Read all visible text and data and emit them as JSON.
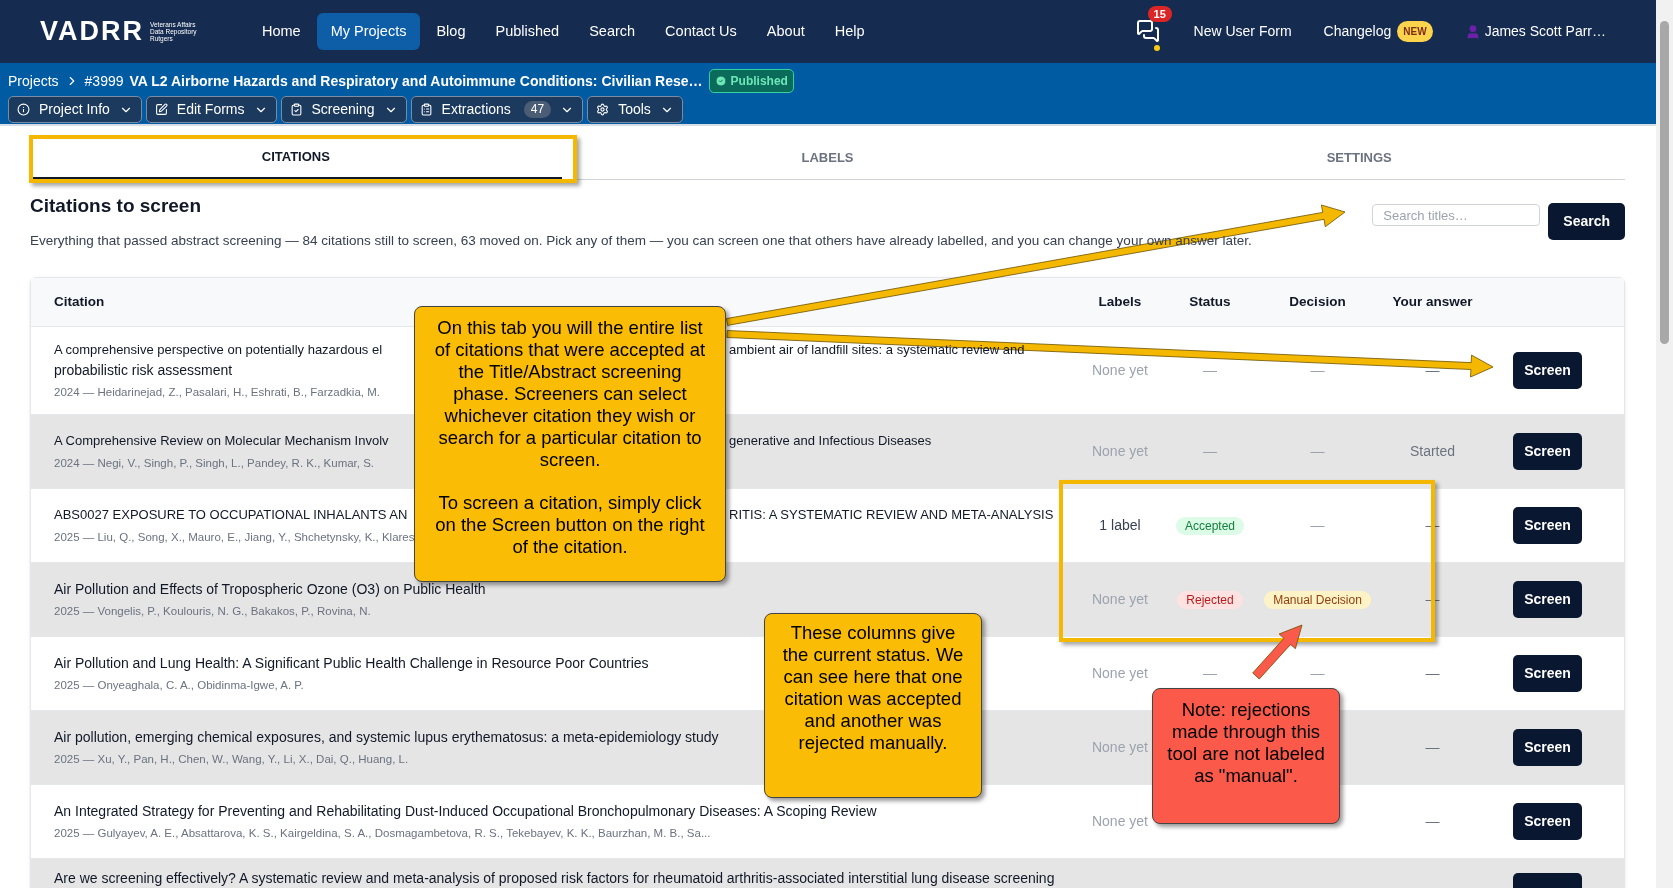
{
  "nav": {
    "logo": {
      "word": "VADRR",
      "tagline": [
        "Veterans Affairs",
        "Data Repository",
        "Rutgers"
      ]
    },
    "links": [
      {
        "label": "Home",
        "selected": false
      },
      {
        "label": "My Projects",
        "selected": true
      },
      {
        "label": "Blog",
        "selected": false
      },
      {
        "label": "Published",
        "selected": false
      },
      {
        "label": "Search",
        "selected": false
      },
      {
        "label": "Contact Us",
        "selected": false
      },
      {
        "label": "About",
        "selected": false
      },
      {
        "label": "Help",
        "selected": false
      }
    ],
    "messages_count": "15",
    "new_user_form": "New User Form",
    "changelog": {
      "label": "Changelog",
      "badge": "NEW"
    },
    "user": "James Scott Parr…"
  },
  "project_bar": {
    "breadcrumb": "Projects",
    "number": "#3999",
    "title": "VA L2 Airborne Hazards and Respiratory and Autoimmune Conditions: Civilian Rese…",
    "status": "Published",
    "menus": [
      {
        "label": "Project Info"
      },
      {
        "label": "Edit Forms"
      },
      {
        "label": "Screening"
      },
      {
        "label": "Extractions",
        "count": "47"
      },
      {
        "label": "Tools"
      }
    ]
  },
  "tabs": [
    {
      "label": "CITATIONS",
      "selected": true
    },
    {
      "label": "LABELS",
      "selected": false
    },
    {
      "label": "SETTINGS",
      "selected": false
    }
  ],
  "section": {
    "title": "Citations to screen",
    "subtitle": "Everything that passed abstract screening — 84 citations still to screen, 63 moved on. Pick any of them — you can screen one that others have already labelled, and you can change your own answer later.",
    "search": {
      "placeholder": "Search titles…",
      "button": "Search"
    }
  },
  "table": {
    "columns": [
      "Citation",
      "Labels",
      "Status",
      "Decision",
      "Your answer"
    ],
    "rows": [
      {
        "title_lines": [
          [
            "A comprehensive perspective on potentially hazardous el",
            "ambient air of landfill sites: a systematic review and"
          ],
          [
            "probabilistic risk assessment"
          ]
        ],
        "authors": "2024 — Heidarinejad, Z., Pasalari, H., Eshrati, B., Farzadkia, M.",
        "labels": "None yet",
        "status": {
          "text": "—",
          "kind": "none"
        },
        "decision": {
          "text": "—",
          "kind": "none"
        },
        "answer": "—",
        "action": "Screen"
      },
      {
        "title_lines": [
          [
            "A Comprehensive Review on Molecular Mechanism Involv",
            "generative and Infectious Diseases"
          ]
        ],
        "authors": "2024 — Negi, V., Singh, P., Singh, L., Pandey, R. K., Kumar, S.",
        "labels": "None yet",
        "status": {
          "text": "—",
          "kind": "none"
        },
        "decision": {
          "text": "—",
          "kind": "none"
        },
        "answer": "Started",
        "action": "Screen"
      },
      {
        "title_lines": [
          [
            "ABS0027 EXPOSURE TO OCCUPATIONAL INHALANTS AN",
            "RITIS: A SYSTEMATIC REVIEW AND META-ANALYSIS"
          ]
        ],
        "authors": "2025 — Liu, Q., Song, X., Mauro, E., Jiang, Y., Shchetynsky, K., Klares",
        "labels": "1 label",
        "status": {
          "text": "Accepted",
          "kind": "accepted"
        },
        "decision": {
          "text": "—",
          "kind": "none"
        },
        "answer": "—",
        "action": "Screen"
      },
      {
        "title_lines": [
          [
            "Air Pollution and Effects of Tropospheric Ozone (O3) on Public Health"
          ]
        ],
        "authors": "2025 — Vongelis, P., Koulouris, N. G., Bakakos, P., Rovina, N.",
        "labels": "None yet",
        "status": {
          "text": "Rejected",
          "kind": "rejected"
        },
        "decision": {
          "text": "Manual Decision",
          "kind": "manual"
        },
        "answer": "—",
        "action": "Screen"
      },
      {
        "title_lines": [
          [
            "Air Pollution and Lung Health: A Significant Public Health Challenge in Resource Poor Countries"
          ]
        ],
        "authors": "2025 — Onyeaghala, C. A., Obidinma-Igwe, A. P.",
        "labels": "None yet",
        "status": {
          "text": "—",
          "kind": "none"
        },
        "decision": {
          "text": "—",
          "kind": "none"
        },
        "answer": "—",
        "action": "Screen"
      },
      {
        "title_lines": [
          [
            "Air pollution, emerging chemical exposures, and systemic lupus erythematosus: a meta-epidemiology study"
          ]
        ],
        "authors": "2025 — Xu, Y., Pan, H., Chen, W., Wang, Y., Li, X., Dai, Q., Huang, L.",
        "labels": "None yet",
        "answer": "—",
        "action": "Screen"
      },
      {
        "title_lines": [
          [
            "An Integrated Strategy for Preventing and Rehabilitating Dust-Induced Occupational Bronchopulmonary Diseases: A Scoping Review"
          ]
        ],
        "authors": "2025 — Gulyayev, A. E., Absattarova, K. S., Kairgeldina, S. A., Dosmagambetova, R. S., Tekebayev, K. K., Baurzhan, M. B., Sa...",
        "labels": "None yet",
        "answer": "—",
        "action": "Screen"
      },
      {
        "title_lines": [
          [
            "Are we screening effectively? A systematic review and meta-analysis of proposed risk factors for rheumatoid arthritis-associated interstitial lung disease screening"
          ]
        ]
      }
    ]
  },
  "annotations": [
    {
      "color": "#fbbc05",
      "paragraphs": [
        "On this tab you will the entire list of citations that were accepted at the Title/Abstract screening phase. Screeners can select whichever citation they wish or search for a particular citation to screen.",
        "To screen a citation, simply click on the Screen button on the right of the citation."
      ]
    },
    {
      "color": "#fbbc05",
      "paragraphs": [
        "These columns give the current status. We can see here that one citation was accepted and another was rejected manually."
      ]
    },
    {
      "color": "#fb5a4a",
      "paragraphs": [
        "Note: rejections made through this tool are not labeled as \"manual\"."
      ]
    }
  ]
}
